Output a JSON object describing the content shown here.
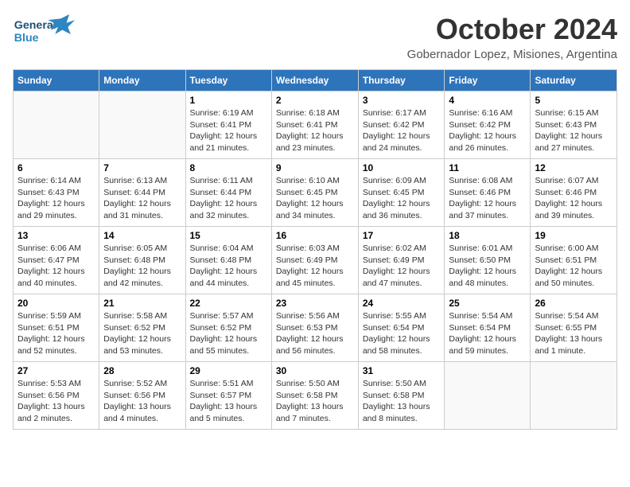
{
  "header": {
    "logo_general": "General",
    "logo_blue": "Blue",
    "month": "October 2024",
    "location": "Gobernador Lopez, Misiones, Argentina"
  },
  "days_of_week": [
    "Sunday",
    "Monday",
    "Tuesday",
    "Wednesday",
    "Thursday",
    "Friday",
    "Saturday"
  ],
  "weeks": [
    [
      {
        "num": "",
        "info": ""
      },
      {
        "num": "",
        "info": ""
      },
      {
        "num": "1",
        "info": "Sunrise: 6:19 AM\nSunset: 6:41 PM\nDaylight: 12 hours and 21 minutes."
      },
      {
        "num": "2",
        "info": "Sunrise: 6:18 AM\nSunset: 6:41 PM\nDaylight: 12 hours and 23 minutes."
      },
      {
        "num": "3",
        "info": "Sunrise: 6:17 AM\nSunset: 6:42 PM\nDaylight: 12 hours and 24 minutes."
      },
      {
        "num": "4",
        "info": "Sunrise: 6:16 AM\nSunset: 6:42 PM\nDaylight: 12 hours and 26 minutes."
      },
      {
        "num": "5",
        "info": "Sunrise: 6:15 AM\nSunset: 6:43 PM\nDaylight: 12 hours and 27 minutes."
      }
    ],
    [
      {
        "num": "6",
        "info": "Sunrise: 6:14 AM\nSunset: 6:43 PM\nDaylight: 12 hours and 29 minutes."
      },
      {
        "num": "7",
        "info": "Sunrise: 6:13 AM\nSunset: 6:44 PM\nDaylight: 12 hours and 31 minutes."
      },
      {
        "num": "8",
        "info": "Sunrise: 6:11 AM\nSunset: 6:44 PM\nDaylight: 12 hours and 32 minutes."
      },
      {
        "num": "9",
        "info": "Sunrise: 6:10 AM\nSunset: 6:45 PM\nDaylight: 12 hours and 34 minutes."
      },
      {
        "num": "10",
        "info": "Sunrise: 6:09 AM\nSunset: 6:45 PM\nDaylight: 12 hours and 36 minutes."
      },
      {
        "num": "11",
        "info": "Sunrise: 6:08 AM\nSunset: 6:46 PM\nDaylight: 12 hours and 37 minutes."
      },
      {
        "num": "12",
        "info": "Sunrise: 6:07 AM\nSunset: 6:46 PM\nDaylight: 12 hours and 39 minutes."
      }
    ],
    [
      {
        "num": "13",
        "info": "Sunrise: 6:06 AM\nSunset: 6:47 PM\nDaylight: 12 hours and 40 minutes."
      },
      {
        "num": "14",
        "info": "Sunrise: 6:05 AM\nSunset: 6:48 PM\nDaylight: 12 hours and 42 minutes."
      },
      {
        "num": "15",
        "info": "Sunrise: 6:04 AM\nSunset: 6:48 PM\nDaylight: 12 hours and 44 minutes."
      },
      {
        "num": "16",
        "info": "Sunrise: 6:03 AM\nSunset: 6:49 PM\nDaylight: 12 hours and 45 minutes."
      },
      {
        "num": "17",
        "info": "Sunrise: 6:02 AM\nSunset: 6:49 PM\nDaylight: 12 hours and 47 minutes."
      },
      {
        "num": "18",
        "info": "Sunrise: 6:01 AM\nSunset: 6:50 PM\nDaylight: 12 hours and 48 minutes."
      },
      {
        "num": "19",
        "info": "Sunrise: 6:00 AM\nSunset: 6:51 PM\nDaylight: 12 hours and 50 minutes."
      }
    ],
    [
      {
        "num": "20",
        "info": "Sunrise: 5:59 AM\nSunset: 6:51 PM\nDaylight: 12 hours and 52 minutes."
      },
      {
        "num": "21",
        "info": "Sunrise: 5:58 AM\nSunset: 6:52 PM\nDaylight: 12 hours and 53 minutes."
      },
      {
        "num": "22",
        "info": "Sunrise: 5:57 AM\nSunset: 6:52 PM\nDaylight: 12 hours and 55 minutes."
      },
      {
        "num": "23",
        "info": "Sunrise: 5:56 AM\nSunset: 6:53 PM\nDaylight: 12 hours and 56 minutes."
      },
      {
        "num": "24",
        "info": "Sunrise: 5:55 AM\nSunset: 6:54 PM\nDaylight: 12 hours and 58 minutes."
      },
      {
        "num": "25",
        "info": "Sunrise: 5:54 AM\nSunset: 6:54 PM\nDaylight: 12 hours and 59 minutes."
      },
      {
        "num": "26",
        "info": "Sunrise: 5:54 AM\nSunset: 6:55 PM\nDaylight: 13 hours and 1 minute."
      }
    ],
    [
      {
        "num": "27",
        "info": "Sunrise: 5:53 AM\nSunset: 6:56 PM\nDaylight: 13 hours and 2 minutes."
      },
      {
        "num": "28",
        "info": "Sunrise: 5:52 AM\nSunset: 6:56 PM\nDaylight: 13 hours and 4 minutes."
      },
      {
        "num": "29",
        "info": "Sunrise: 5:51 AM\nSunset: 6:57 PM\nDaylight: 13 hours and 5 minutes."
      },
      {
        "num": "30",
        "info": "Sunrise: 5:50 AM\nSunset: 6:58 PM\nDaylight: 13 hours and 7 minutes."
      },
      {
        "num": "31",
        "info": "Sunrise: 5:50 AM\nSunset: 6:58 PM\nDaylight: 13 hours and 8 minutes."
      },
      {
        "num": "",
        "info": ""
      },
      {
        "num": "",
        "info": ""
      }
    ]
  ]
}
